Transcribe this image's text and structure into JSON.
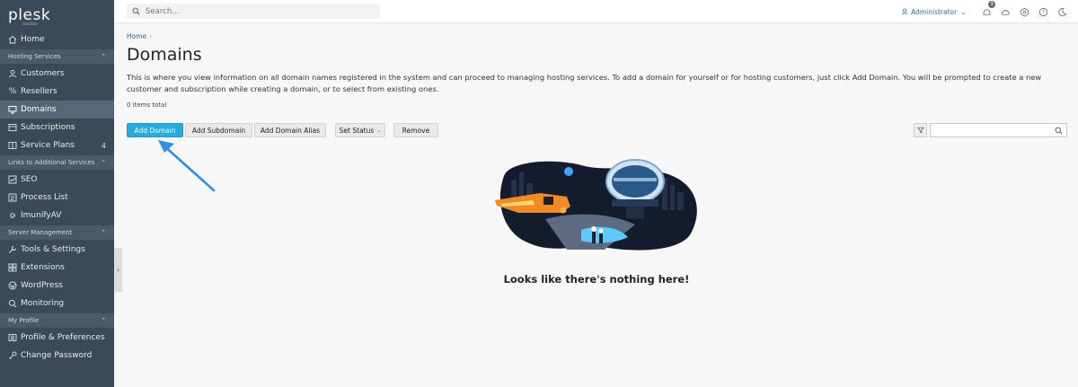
{
  "app": {
    "logo": "plesk",
    "logo_sub": "obsidian"
  },
  "sidebar": {
    "items_top": [
      {
        "label": "Home",
        "icon": "home-icon"
      }
    ],
    "sections": [
      {
        "title": "Hosting Services",
        "items": [
          {
            "label": "Customers",
            "icon": "user-icon"
          },
          {
            "label": "Resellers",
            "icon": "percent-icon"
          },
          {
            "label": "Domains",
            "icon": "monitor-icon",
            "active": true
          },
          {
            "label": "Subscriptions",
            "icon": "subscriptions-icon"
          },
          {
            "label": "Service Plans",
            "icon": "plans-icon",
            "count": "4"
          }
        ]
      },
      {
        "title": "Links to Additional Services",
        "items": [
          {
            "label": "SEO",
            "icon": "chart-icon"
          },
          {
            "label": "Process List",
            "icon": "list-icon"
          },
          {
            "label": "ImunifyAV",
            "icon": "gear-icon"
          }
        ]
      },
      {
        "title": "Server Management",
        "items": [
          {
            "label": "Tools & Settings",
            "icon": "tools-icon"
          },
          {
            "label": "Extensions",
            "icon": "extensions-icon"
          },
          {
            "label": "WordPress",
            "icon": "wordpress-icon"
          },
          {
            "label": "Monitoring",
            "icon": "monitoring-icon"
          }
        ]
      },
      {
        "title": "My Profile",
        "items": [
          {
            "label": "Profile & Preferences",
            "icon": "profile-icon"
          },
          {
            "label": "Change Password",
            "icon": "key-icon"
          }
        ]
      }
    ]
  },
  "topbar": {
    "search_placeholder": "Search...",
    "user": "Administrator",
    "notifications_count": "3"
  },
  "main": {
    "breadcrumb_home": "Home",
    "title": "Domains",
    "description": "This is where you view information on all domain names registered in the system and can proceed to managing hosting services. To add a domain for yourself or for hosting customers, just click Add Domain. You will be prompted to create a new customer and subscription while creating a domain, or to select from existing ones.",
    "items_total": "0 items total",
    "buttons": {
      "add_domain": "Add Domain",
      "add_subdomain": "Add Subdomain",
      "add_domain_alias": "Add Domain Alias",
      "set_status": "Set Status",
      "remove": "Remove"
    },
    "empty_text": "Looks like there's nothing here!"
  },
  "colors": {
    "sidebar": "#3b4a59",
    "primary": "#28aade",
    "arrow": "#2f8fe8"
  }
}
